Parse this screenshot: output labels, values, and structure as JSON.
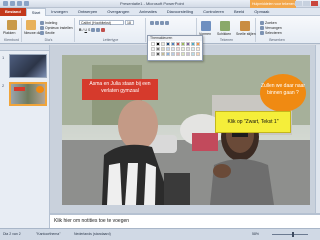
{
  "window": {
    "title": "Presentatie1 - Microsoft PowerPoint",
    "context_tab": "Hulpmiddelen voor tekenen"
  },
  "tabs": [
    "Bestand",
    "Start",
    "Invoegen",
    "Ontwerpen",
    "Overgangen",
    "Animaties",
    "Diavoorstelling",
    "Controleren",
    "Beeld",
    "Opmaak"
  ],
  "ribbon": {
    "groups": [
      "Klembord",
      "Dia's",
      "Lettertype",
      "Alinea",
      "Tekenen",
      "Bewerken"
    ],
    "paste_label": "Plakken",
    "new_slide_label": "Nieuwe dia",
    "layout_label": "Indeling",
    "reset_label": "Opnieuw instellen",
    "section_label": "Sectie",
    "font_name": "Calibri (Hoofdtekst)",
    "font_size": "18",
    "find_label": "Zoeken",
    "replace_label": "Vervangen",
    "select_label": "Selecteren",
    "shapes_label": "Vormen",
    "arrange_label": "Schikken",
    "quick_styles_label": "Snelle stijlen"
  },
  "palette": {
    "header": "Themakleuren",
    "colors": [
      "#ffffff",
      "#000000",
      "#eeece1",
      "#1f497d",
      "#4f81bd",
      "#c0504d",
      "#9bbb59",
      "#8064a2",
      "#4bacc6",
      "#f79646",
      "#f2f2f2",
      "#7f7f7f",
      "#ddd9c3",
      "#c6d9f0",
      "#dbe5f1",
      "#f2dcdb",
      "#ebf1dd",
      "#e5e0ec",
      "#dbeef3",
      "#fdeada",
      "#d8d8d8",
      "#595959",
      "#c4bd97",
      "#8db3e2",
      "#b8cce4",
      "#e5b9b7",
      "#d7e3bc",
      "#ccc1d9",
      "#b7dde8",
      "#fbd5b5"
    ]
  },
  "slide": {
    "callout_red": "Asma en Julia staan bij een verlaten gymzaal",
    "callout_orange": "Zullen we daar naar binnen gaan ?",
    "callout_yellow": "Klik op \"Zwart, Tekst 1\""
  },
  "thumbnails": [
    {
      "num": "1"
    },
    {
      "num": "2"
    }
  ],
  "notes_placeholder": "Klik hier om notities toe te voegen",
  "status": {
    "slide_info": "Dia 2 van 2",
    "theme": "\"Kantoorthema\"",
    "language": "Nederlands (standaard)",
    "zoom": "58%"
  },
  "colors": {
    "file_tab": "#c3381b",
    "red_callout": "#d63a2c",
    "orange_callout": "#f08a12",
    "yellow_callout": "#f5ee3a"
  }
}
